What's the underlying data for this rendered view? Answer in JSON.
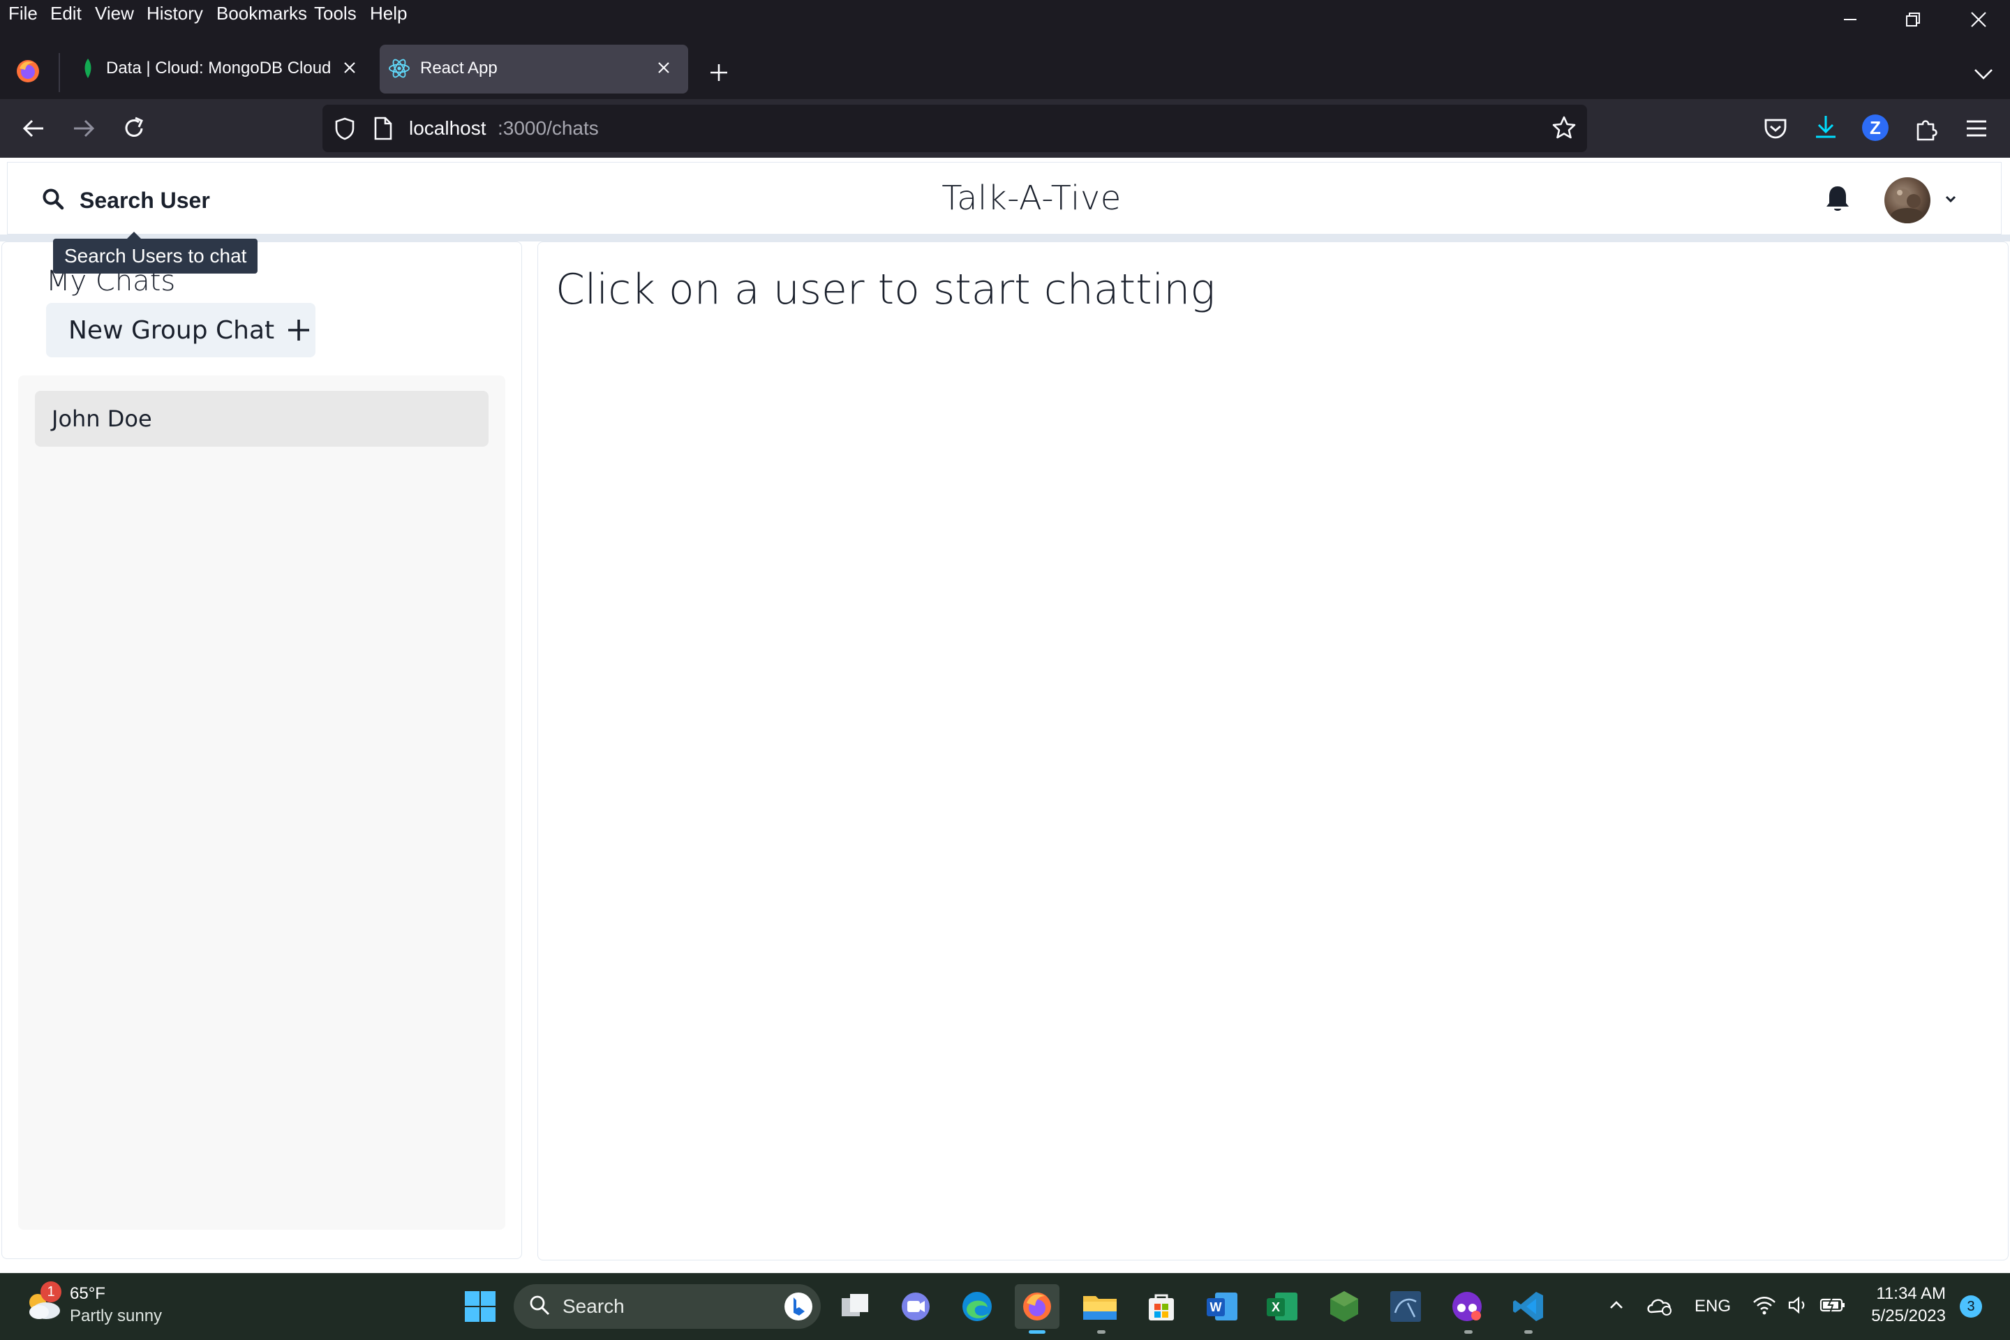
{
  "browser": {
    "menu": [
      "File",
      "Edit",
      "View",
      "History",
      "Bookmarks",
      "Tools",
      "Help"
    ],
    "tabs": [
      {
        "title": "Data | Cloud: MongoDB Cloud",
        "active": false
      },
      {
        "title": "React App",
        "active": true
      }
    ],
    "url_host": "localhost",
    "url_path": ":3000/chats"
  },
  "app": {
    "search_label": "Search User",
    "search_tooltip": "Search Users to chat",
    "title": "Talk-A-Tive",
    "my_chats_title": "My Chats",
    "new_group_label": "New Group Chat",
    "chats": [
      {
        "name": "John Doe"
      }
    ],
    "empty_message": "Click on a user to start chatting"
  },
  "taskbar": {
    "weather_temp": "65°F",
    "weather_desc": "Partly sunny",
    "weather_badge": "1",
    "search_placeholder": "Search",
    "lang": "ENG",
    "time": "11:34 AM",
    "date": "5/25/2023",
    "notif_count": "3"
  },
  "colors": {
    "browser_bg": "#1c1b22",
    "toolbar_bg": "#2b2a33",
    "tooltip_bg": "#2d3748",
    "button_bg": "#edf2f7",
    "taskbar_bg": "#1f2b24"
  }
}
